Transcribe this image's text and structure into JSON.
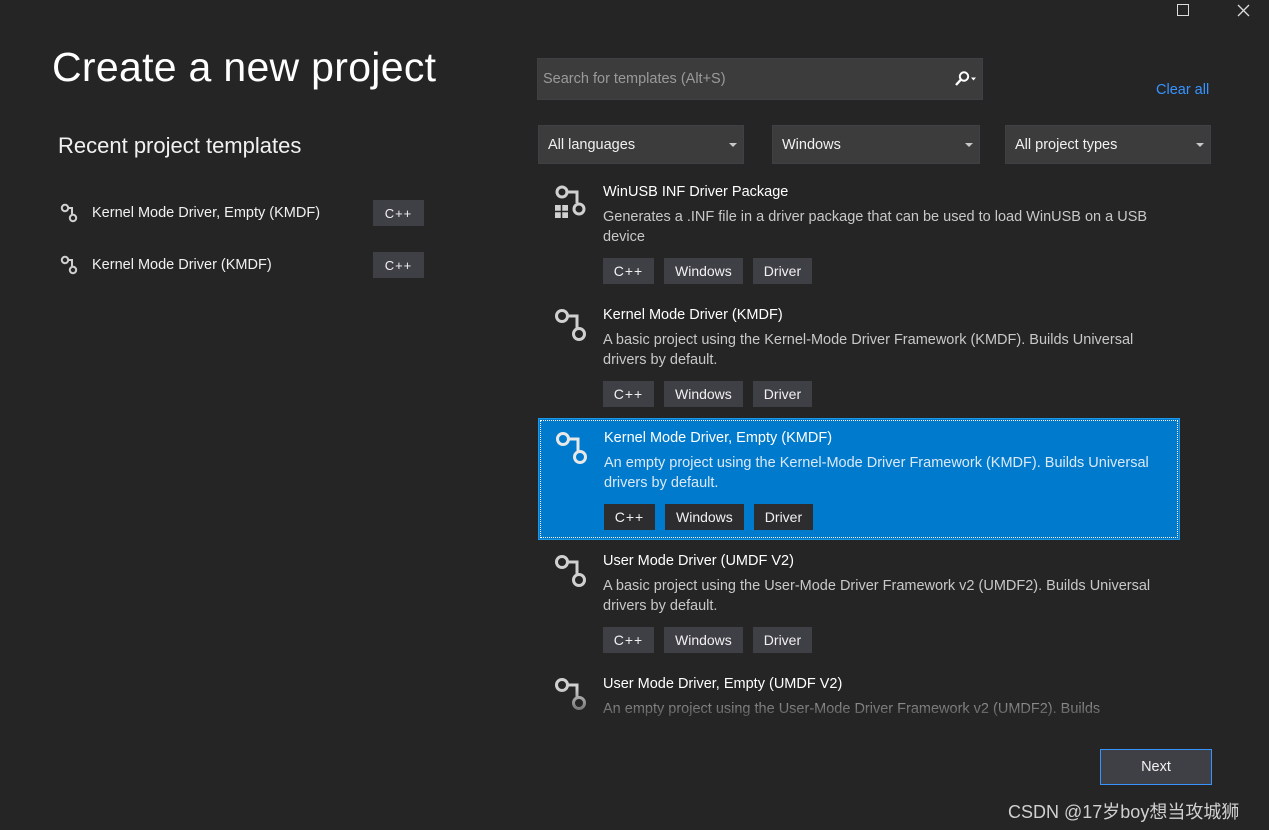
{
  "window_controls": {
    "maximize_icon": "maximize-icon",
    "close_icon": "close-icon"
  },
  "page_title": "Create a new project",
  "recent": {
    "heading": "Recent project templates",
    "items": [
      {
        "label": "Kernel Mode Driver, Empty (KMDF)",
        "tag": "C++",
        "icon": "driver-icon"
      },
      {
        "label": "Kernel Mode Driver (KMDF)",
        "tag": "C++",
        "icon": "driver-icon"
      }
    ]
  },
  "search": {
    "placeholder": "Search for templates (Alt+S)",
    "icon": "search-icon"
  },
  "clear_all": "Clear all",
  "filters": {
    "language": "All languages",
    "platform": "Windows",
    "project_type": "All project types"
  },
  "templates": [
    {
      "name": "WinUSB INF Driver Package",
      "description": "Generates a .INF file in a driver package that can be used to load WinUSB on a USB device",
      "tags": [
        "C++",
        "Windows",
        "Driver"
      ],
      "icon": "driver-package-icon",
      "selected": false
    },
    {
      "name": "Kernel Mode Driver (KMDF)",
      "description": "A basic project using the Kernel-Mode Driver Framework (KMDF). Builds Universal drivers by default.",
      "tags": [
        "C++",
        "Windows",
        "Driver"
      ],
      "icon": "driver-icon",
      "selected": false
    },
    {
      "name": "Kernel Mode Driver, Empty (KMDF)",
      "description": "An empty project using the Kernel-Mode Driver Framework (KMDF). Builds Universal drivers by default.",
      "tags": [
        "C++",
        "Windows",
        "Driver"
      ],
      "icon": "driver-icon",
      "selected": true
    },
    {
      "name": "User Mode Driver (UMDF V2)",
      "description": "A basic project using the User-Mode Driver Framework v2 (UMDF2). Builds Universal drivers by default.",
      "tags": [
        "C++",
        "Windows",
        "Driver"
      ],
      "icon": "driver-icon",
      "selected": false
    },
    {
      "name": "User Mode Driver, Empty (UMDF V2)",
      "description": "An empty project using the User-Mode Driver Framework v2 (UMDF2). Builds",
      "tags": [],
      "icon": "driver-icon",
      "selected": false
    }
  ],
  "next_button": "Next",
  "watermark": "CSDN @17岁boy想当攻城狮",
  "colors": {
    "background": "#252526",
    "accent": "#007acc",
    "link": "#3794ff",
    "tag_bg": "#3f3f46"
  }
}
